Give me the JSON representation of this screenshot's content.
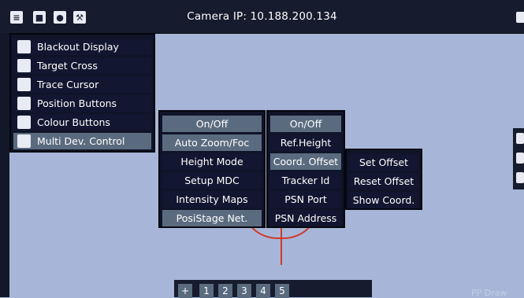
{
  "topbar": {
    "title": "Camera IP: 10.188.200.134",
    "icons": [
      "sliders-icon",
      "camera-icon",
      "user-icon",
      "wrench-icon"
    ]
  },
  "main_menu": {
    "items": [
      {
        "label": "Blackout Display",
        "icon": "square-icon"
      },
      {
        "label": "Target Cross",
        "icon": "crosshair-icon"
      },
      {
        "label": "Trace Cursor",
        "icon": "move-icon"
      },
      {
        "label": "Position Buttons",
        "icon": "target-circle-icon"
      },
      {
        "label": "Colour Buttons",
        "icon": "brush-icon"
      },
      {
        "label": "Multi Dev. Control",
        "icon": "users-icon"
      }
    ]
  },
  "mdc_menu": {
    "items": [
      "On/Off",
      "Auto Zoom/Foc",
      "Height Mode",
      "Setup MDC",
      "Intensity Maps",
      "PosiStage Net."
    ]
  },
  "psn_menu": {
    "items": [
      "On/Off",
      "Ref.Height",
      "Coord. Offset",
      "Tracker Id",
      "PSN Port",
      "PSN Address"
    ]
  },
  "offset_menu": {
    "items": [
      "Set Offset",
      "Reset Offset",
      "Show Coord."
    ]
  },
  "bottom_bar": {
    "buttons": [
      "+",
      "1",
      "2",
      "3",
      "4",
      "5"
    ]
  },
  "watermark": "PP Draw"
}
